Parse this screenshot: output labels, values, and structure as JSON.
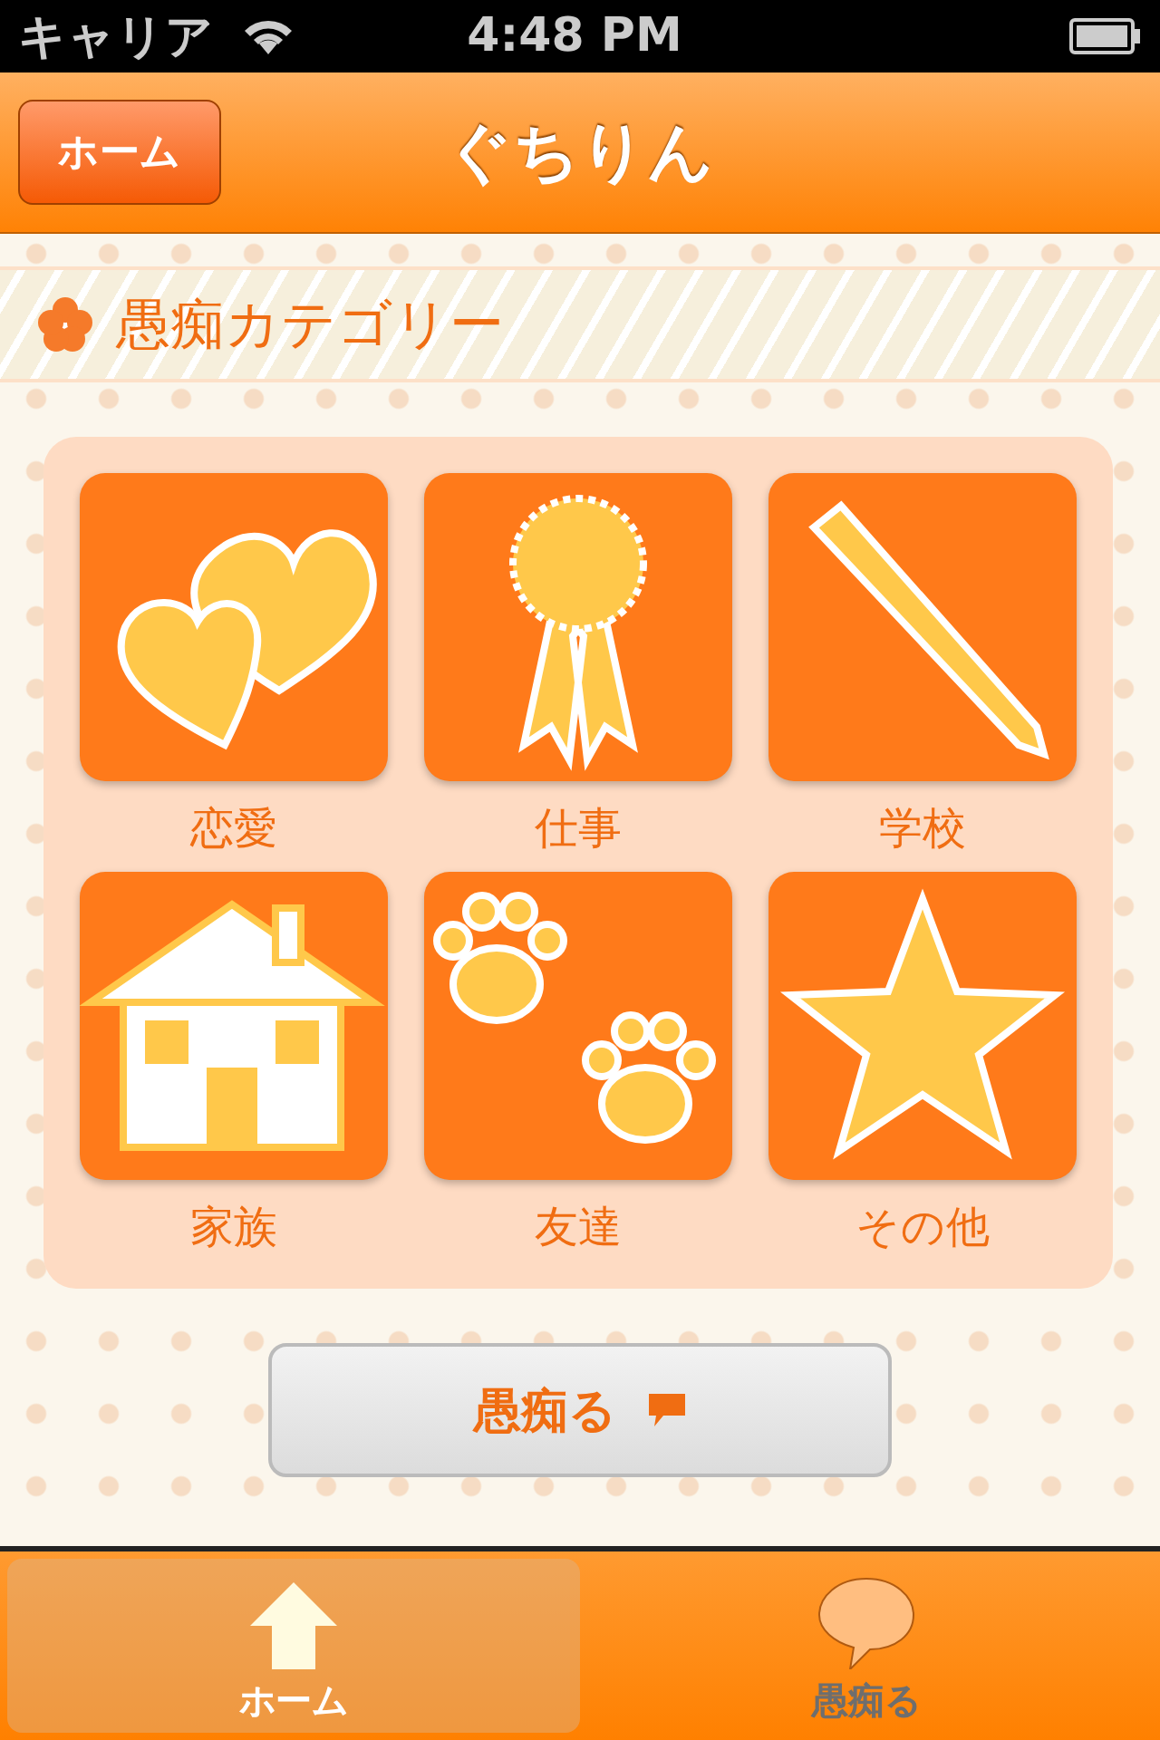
{
  "status_bar": {
    "carrier": "キャリア",
    "time": "4:48 PM"
  },
  "nav_bar": {
    "back_button": "ホーム",
    "title": "ぐちりん"
  },
  "section": {
    "title": "愚痴カテゴリー"
  },
  "categories": [
    {
      "label": "恋愛",
      "kind": "hearts"
    },
    {
      "label": "仕事",
      "kind": "ribbon"
    },
    {
      "label": "学校",
      "kind": "pen"
    },
    {
      "label": "家族",
      "kind": "house"
    },
    {
      "label": "友達",
      "kind": "paws"
    },
    {
      "label": "その他",
      "kind": "star"
    }
  ],
  "action_button": {
    "label": "愚痴る"
  },
  "tab_bar": [
    {
      "label": "ホーム",
      "kind": "home",
      "selected": true
    },
    {
      "label": "愚痴る",
      "kind": "bubble",
      "selected": false
    }
  ]
}
